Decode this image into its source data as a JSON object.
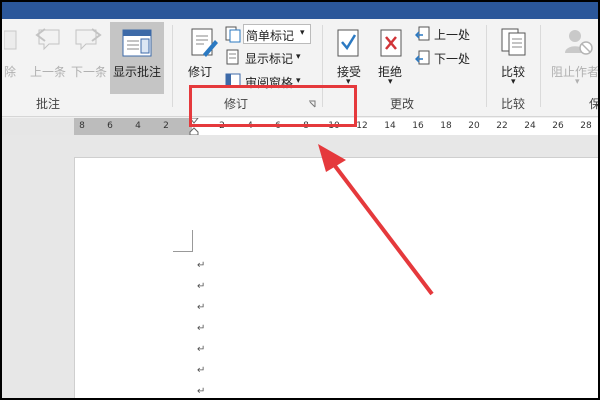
{
  "ribbon": {
    "comments": {
      "delete_label": "除",
      "previous_label": "上一条",
      "next_label": "下一条",
      "show_comments_label": "显示批注",
      "group_label": "批注"
    },
    "tracking": {
      "track_changes_label": "修订",
      "simple_markup_value": "简单标记",
      "show_markup_label": "显示标记",
      "reviewing_pane_label": "审阅窗格",
      "group_label": "修订"
    },
    "changes": {
      "accept_label": "接受",
      "reject_label": "拒绝",
      "previous_label": "上一处",
      "next_label": "下一处",
      "group_label": "更改"
    },
    "compare": {
      "compare_label": "比较",
      "group_label": "比较"
    },
    "protect": {
      "block_authors_label": "阻止作者",
      "group_label_partial": "保"
    }
  },
  "ruler": {
    "ticks": [
      "8",
      "6",
      "4",
      "2",
      "2",
      "4",
      "6",
      "8",
      "10",
      "12",
      "14",
      "16",
      "18",
      "20",
      "22",
      "24",
      "26",
      "28"
    ]
  },
  "document": {
    "paragraph_mark": "↵"
  },
  "colors": {
    "titlebar": "#2b579a",
    "highlight": "#e5393c",
    "accept_check": "#2b79c2",
    "reject_x": "#d13438"
  }
}
